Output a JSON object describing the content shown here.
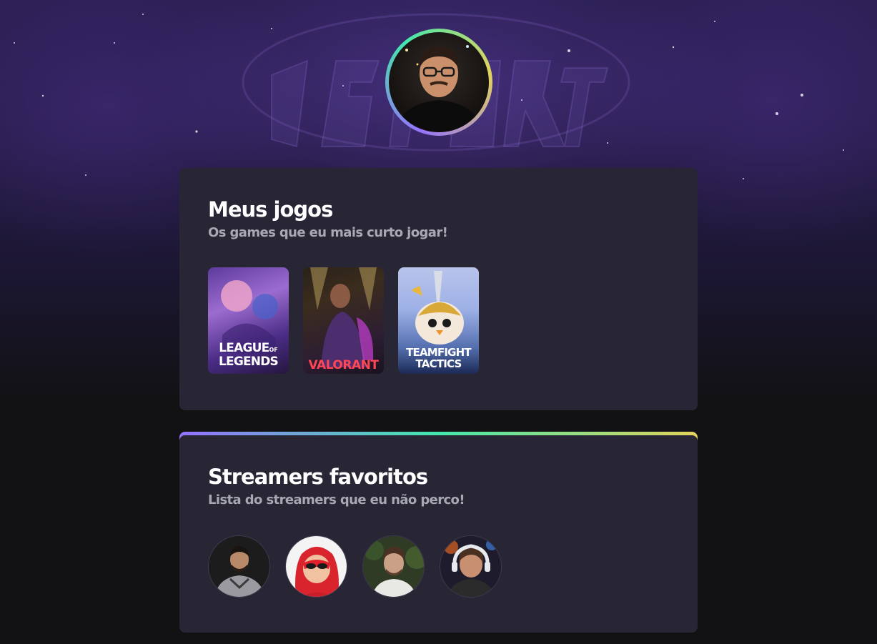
{
  "profile": {
    "avatar_alt": "profile-photo"
  },
  "games_section": {
    "title": "Meus jogos",
    "subtitle": "Os games que eu mais curto jogar!",
    "games": [
      {
        "name": "League of Legends",
        "logo_line1": "LEAGUE",
        "logo_of": "OF",
        "logo_line2": "LEGENDS"
      },
      {
        "name": "Valorant",
        "logo_text": "VALORANT"
      },
      {
        "name": "Teamfight Tactics",
        "logo_line1": "TEAMFIGHT",
        "logo_line2": "TACTICS"
      }
    ]
  },
  "streamers_section": {
    "title": "Streamers favoritos",
    "subtitle": "Lista do streamers que eu não perco!",
    "streamers": [
      {
        "id": "streamer-1"
      },
      {
        "id": "streamer-2"
      },
      {
        "id": "streamer-3"
      },
      {
        "id": "streamer-4"
      }
    ]
  },
  "colors": {
    "background": "#121214",
    "card": "#282535",
    "gradient_start": "#9572fc",
    "gradient_mid": "#43e7ad",
    "gradient_end": "#e2d45c",
    "subtitle": "#a8a8b3"
  }
}
